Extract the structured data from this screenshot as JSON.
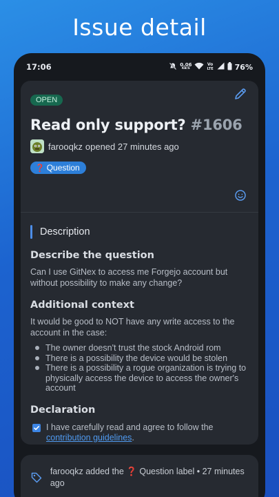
{
  "headline": "Issue detail",
  "status_bar": {
    "time": "17:06",
    "speed_value": "0.06",
    "speed_unit": "KB/S",
    "volte": "Vo",
    "lte": "LTE",
    "battery": "76%"
  },
  "issue": {
    "state": "OPEN",
    "title": "Read only support?",
    "number": "#1606",
    "author": "farooqkz",
    "opened_text": "opened 27 minutes ago",
    "label": {
      "icon": "❓",
      "text": "Question",
      "color": "#2d7fd9"
    }
  },
  "description": {
    "header": "Description",
    "section1_title": "Describe the question",
    "section1_body": "Can I use GitNex to access me Forgejo account but without possibility to make any change?",
    "section2_title": "Additional context",
    "section2_body": "It would be good to NOT have any write access to the account in the case:",
    "bullets": [
      "The owner doesn't trust the stock Android rom",
      "There is a possibility the device would be stolen",
      "There is a possibility a rogue organization is trying to physically access the device to access the owner's account"
    ],
    "section3_title": "Declaration",
    "declaration_text": "I have carefully read and agree to follow the",
    "declaration_link": "contribution guidelines",
    "declaration_end": "."
  },
  "event": {
    "text": "farooqkz added the ❓ Question label • 27 minutes ago"
  },
  "colors": {
    "accent": "#4d8ee8",
    "open_badge": "#17684f",
    "card": "#262a31",
    "screen": "#16191e"
  }
}
